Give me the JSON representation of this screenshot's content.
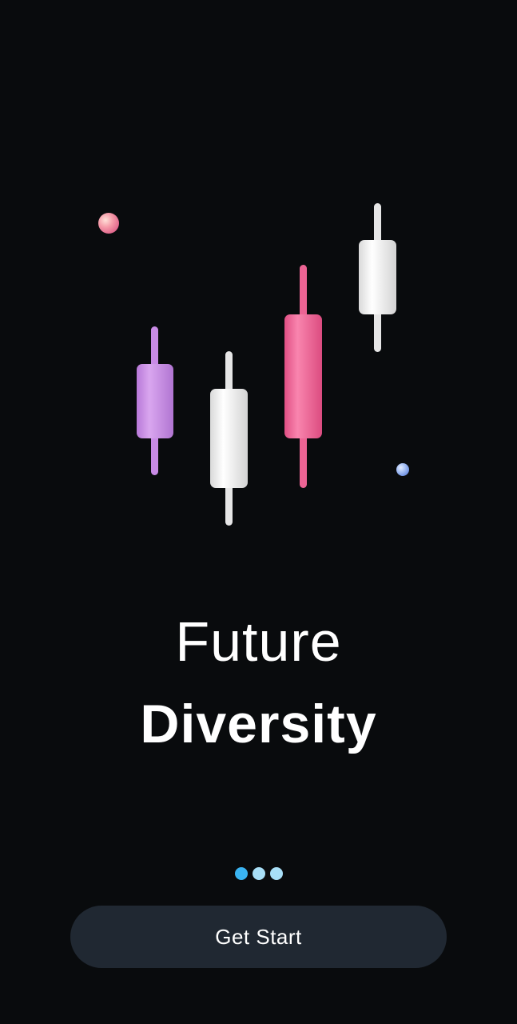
{
  "headline": {
    "line1": "Future",
    "line2": "Diversity"
  },
  "illustration": {
    "icon": "candlestick-chart-icon",
    "colors": {
      "purple": "#c98be6",
      "white": "#f1f1f1",
      "pink": "#f06a98",
      "orb_pink": "#f7a0ac",
      "orb_blue": "#9bb8f2"
    }
  },
  "pager": {
    "count": 3,
    "active_index": 0,
    "active_color": "#3ab4f2",
    "inactive_color": "#a8dff7"
  },
  "cta": {
    "label": "Get Start",
    "background": "#202832"
  },
  "theme": {
    "background": "#090b0d"
  }
}
